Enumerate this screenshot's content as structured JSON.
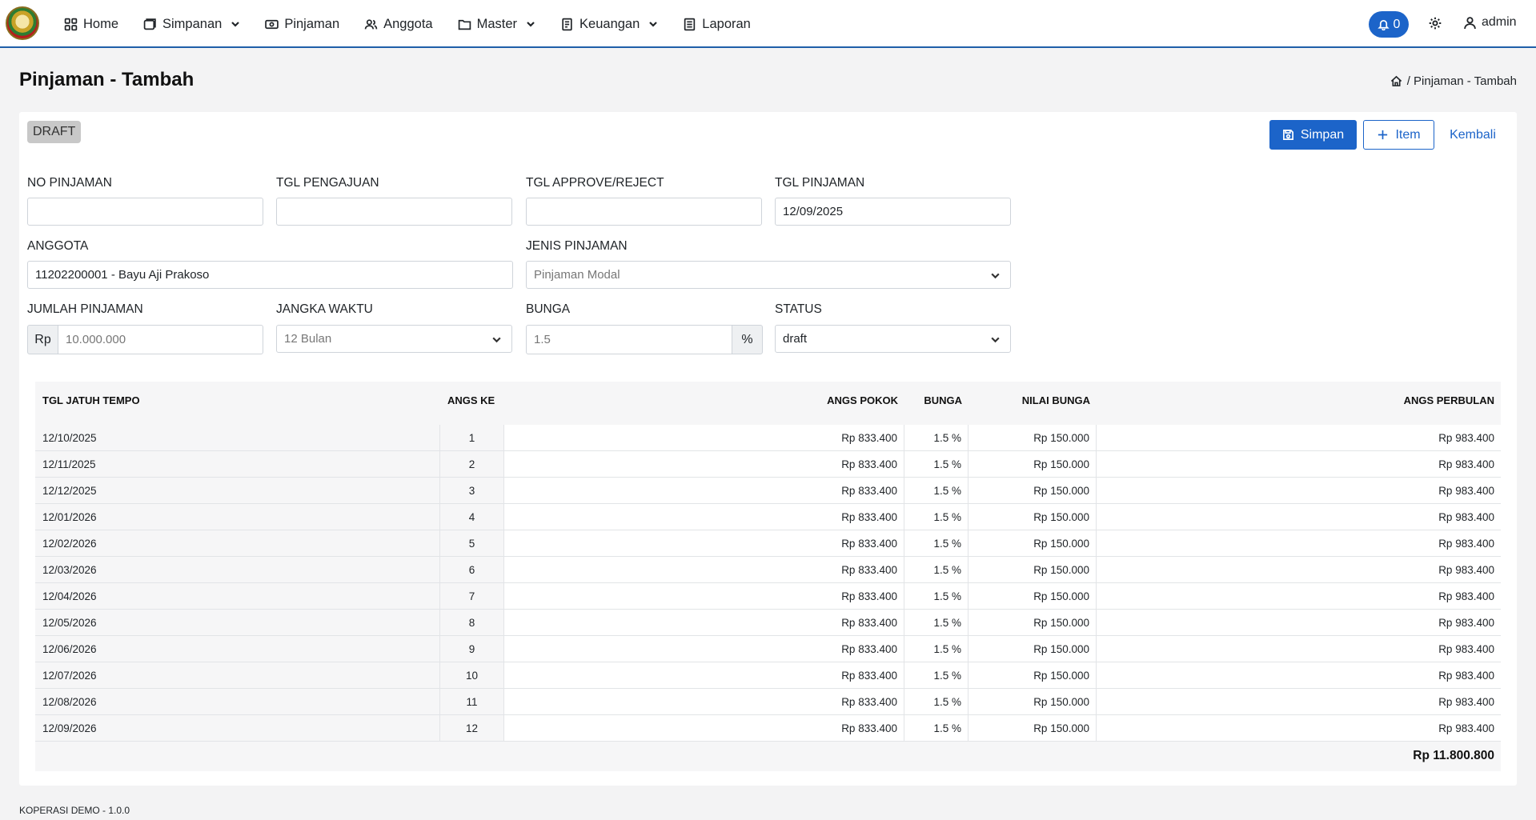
{
  "nav": {
    "items": [
      {
        "label": "Home",
        "icon": "grid-icon",
        "dropdown": false
      },
      {
        "label": "Simpanan",
        "icon": "wallet-icon",
        "dropdown": true
      },
      {
        "label": "Pinjaman",
        "icon": "money-icon",
        "dropdown": false
      },
      {
        "label": "Anggota",
        "icon": "users-icon",
        "dropdown": false
      },
      {
        "label": "Master",
        "icon": "folder-icon",
        "dropdown": true
      },
      {
        "label": "Keuangan",
        "icon": "ledger-icon",
        "dropdown": true
      },
      {
        "label": "Laporan",
        "icon": "report-icon",
        "dropdown": false
      }
    ],
    "notification_count": "0",
    "user": "admin"
  },
  "page": {
    "title": "Pinjaman - Tambah",
    "breadcrumb": "/ Pinjaman - Tambah"
  },
  "form": {
    "status_badge": "DRAFT",
    "buttons": {
      "save": "Simpan",
      "item": "Item",
      "back": "Kembali"
    },
    "no_pinjaman": {
      "label": "NO PINJAMAN",
      "value": ""
    },
    "tgl_pengajuan": {
      "label": "TGL PENGAJUAN",
      "value": ""
    },
    "tgl_approve": {
      "label": "TGL APPROVE/REJECT",
      "value": ""
    },
    "tgl_pinjaman": {
      "label": "TGL PINJAMAN",
      "value": "12/09/2025"
    },
    "anggota": {
      "label": "ANGGOTA",
      "value": "11202200001 - Bayu Aji Prakoso"
    },
    "jenis_pinjaman": {
      "label": "JENIS PINJAMAN",
      "value": "Pinjaman Modal"
    },
    "jumlah_pinjaman": {
      "label": "JUMLAH PINJAMAN",
      "prefix": "Rp",
      "value": "10.000.000"
    },
    "jangka_waktu": {
      "label": "JANGKA WAKTU",
      "value": "12 Bulan"
    },
    "bunga": {
      "label": "BUNGA",
      "value": "1.5",
      "suffix": "%"
    },
    "status": {
      "label": "STATUS",
      "value": "draft"
    }
  },
  "schedule": {
    "headers": {
      "tgl": "TGL JATUH TEMPO",
      "ke": "ANGS KE",
      "pokok": "ANGS POKOK",
      "bunga": "BUNGA",
      "nilai": "NILAI BUNGA",
      "perbulan": "ANGS PERBULAN"
    },
    "rows": [
      {
        "tgl": "12/10/2025",
        "ke": "1",
        "pokok": "Rp 833.400",
        "bunga": "1.5 %",
        "nilai": "Rp 150.000",
        "perbulan": "Rp 983.400"
      },
      {
        "tgl": "12/11/2025",
        "ke": "2",
        "pokok": "Rp 833.400",
        "bunga": "1.5 %",
        "nilai": "Rp 150.000",
        "perbulan": "Rp 983.400"
      },
      {
        "tgl": "12/12/2025",
        "ke": "3",
        "pokok": "Rp 833.400",
        "bunga": "1.5 %",
        "nilai": "Rp 150.000",
        "perbulan": "Rp 983.400"
      },
      {
        "tgl": "12/01/2026",
        "ke": "4",
        "pokok": "Rp 833.400",
        "bunga": "1.5 %",
        "nilai": "Rp 150.000",
        "perbulan": "Rp 983.400"
      },
      {
        "tgl": "12/02/2026",
        "ke": "5",
        "pokok": "Rp 833.400",
        "bunga": "1.5 %",
        "nilai": "Rp 150.000",
        "perbulan": "Rp 983.400"
      },
      {
        "tgl": "12/03/2026",
        "ke": "6",
        "pokok": "Rp 833.400",
        "bunga": "1.5 %",
        "nilai": "Rp 150.000",
        "perbulan": "Rp 983.400"
      },
      {
        "tgl": "12/04/2026",
        "ke": "7",
        "pokok": "Rp 833.400",
        "bunga": "1.5 %",
        "nilai": "Rp 150.000",
        "perbulan": "Rp 983.400"
      },
      {
        "tgl": "12/05/2026",
        "ke": "8",
        "pokok": "Rp 833.400",
        "bunga": "1.5 %",
        "nilai": "Rp 150.000",
        "perbulan": "Rp 983.400"
      },
      {
        "tgl": "12/06/2026",
        "ke": "9",
        "pokok": "Rp 833.400",
        "bunga": "1.5 %",
        "nilai": "Rp 150.000",
        "perbulan": "Rp 983.400"
      },
      {
        "tgl": "12/07/2026",
        "ke": "10",
        "pokok": "Rp 833.400",
        "bunga": "1.5 %",
        "nilai": "Rp 150.000",
        "perbulan": "Rp 983.400"
      },
      {
        "tgl": "12/08/2026",
        "ke": "11",
        "pokok": "Rp 833.400",
        "bunga": "1.5 %",
        "nilai": "Rp 150.000",
        "perbulan": "Rp 983.400"
      },
      {
        "tgl": "12/09/2026",
        "ke": "12",
        "pokok": "Rp 833.400",
        "bunga": "1.5 %",
        "nilai": "Rp 150.000",
        "perbulan": "Rp 983.400"
      }
    ],
    "total": "Rp 11.800.800"
  },
  "footer": "KOPERASI DEMO - 1.0.0",
  "colors": {
    "primary": "#1c64c9",
    "badge": "#c8c8c8",
    "background": "#f3f3f4"
  }
}
